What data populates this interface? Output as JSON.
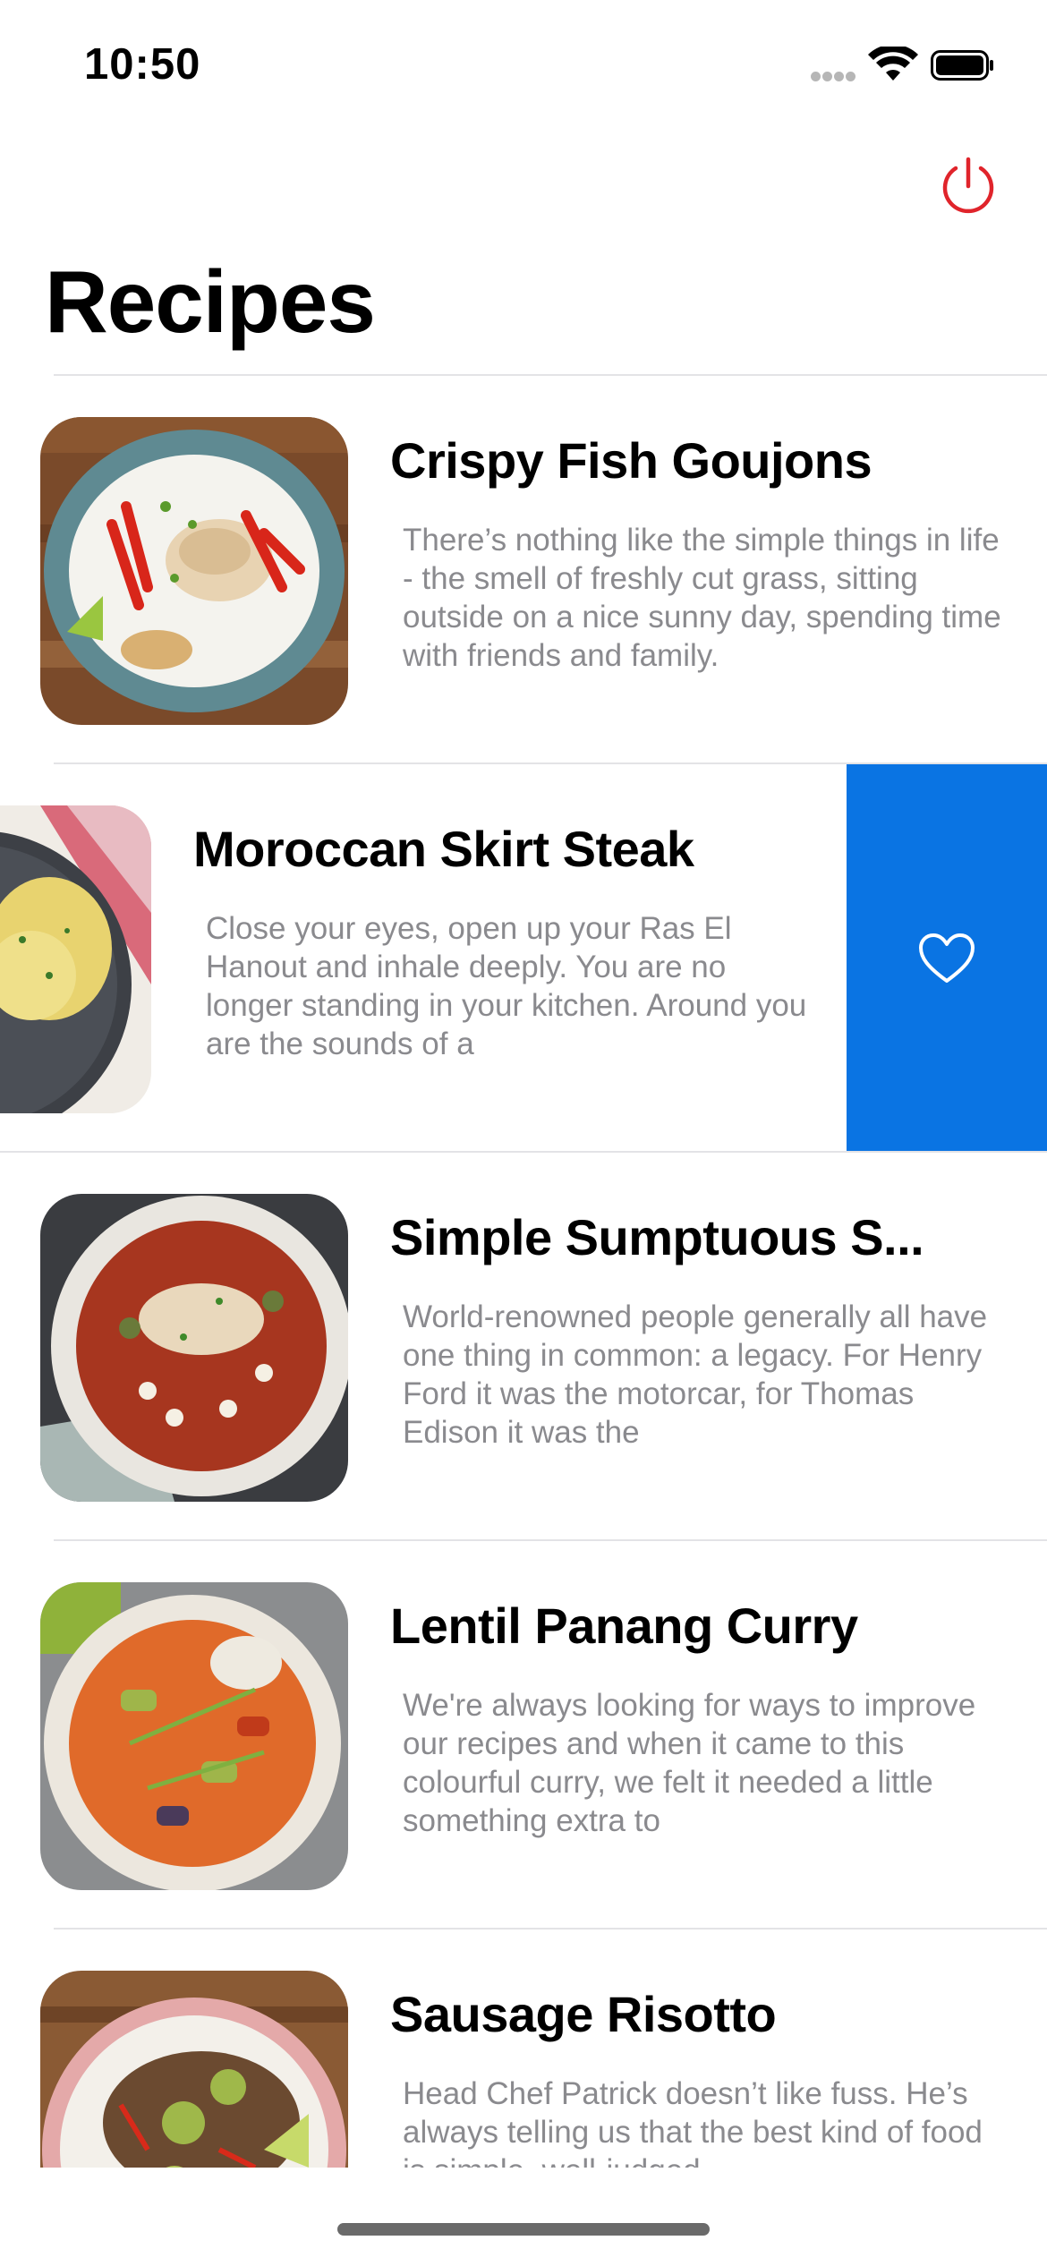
{
  "status_bar": {
    "time": "10:50"
  },
  "header": {
    "title": "Recipes",
    "power_icon": "power-icon",
    "accent_color": "#e0242b"
  },
  "recipes": [
    {
      "title": "Crispy Fish Goujons",
      "description": "There’s nothing like the simple things in life - the smell of freshly cut grass, sitting outside on a nice sunny day, spending time with friends and family."
    },
    {
      "title": "Moroccan Skirt Steak",
      "description": "Close your eyes, open up your Ras El Hanout and inhale deeply. You are no longer standing in your kitchen. Around you are the sounds of a"
    },
    {
      "title": "Simple Sumptuous S...",
      "description": "World-renowned people generally all have one thing in common: a legacy. For Henry Ford it was the motorcar, for Thomas Edison it was the"
    },
    {
      "title": "Lentil Panang Curry",
      "description": "We're always looking for ways to improve our recipes and when it came to this colourful curry, we felt it needed a little something extra to"
    },
    {
      "title": "Sausage Risotto",
      "description": "Head Chef Patrick doesn’t like fuss. He’s always telling us that the best kind of food is simple, well-judged"
    }
  ],
  "swipe_action": {
    "icon": "heart-icon",
    "color": "#0a74e3"
  }
}
